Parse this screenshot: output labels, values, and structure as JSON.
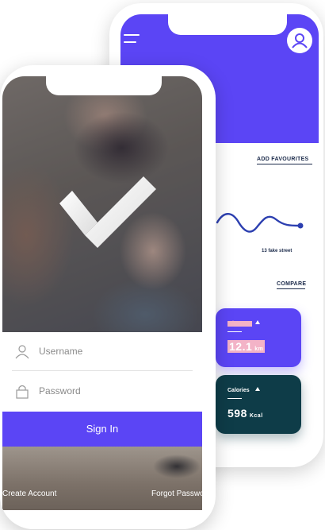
{
  "dashboard": {
    "add_favourites": "ADD FAVOURITES",
    "address": "13 fake street",
    "compare": "COMPARE",
    "cards": [
      {
        "label": "Distance",
        "value": "12.1",
        "unit": "km"
      },
      {
        "label": "Calories",
        "value": "598",
        "unit": "Kcal"
      }
    ]
  },
  "login": {
    "username_placeholder": "Username",
    "password_placeholder": "Password",
    "sign_in_label": "Sign In",
    "create_account_label": "Create Account",
    "forgot_password_label": "Forgot Password"
  },
  "colors": {
    "brand_purple": "#5b45f5",
    "calories_card": "#0e3c48",
    "text_dark": "#1b2a4a"
  },
  "icons": [
    "menu-icon",
    "user-icon",
    "checkmark-logo-icon",
    "person-icon",
    "lock-icon",
    "arrow-up-icon"
  ]
}
